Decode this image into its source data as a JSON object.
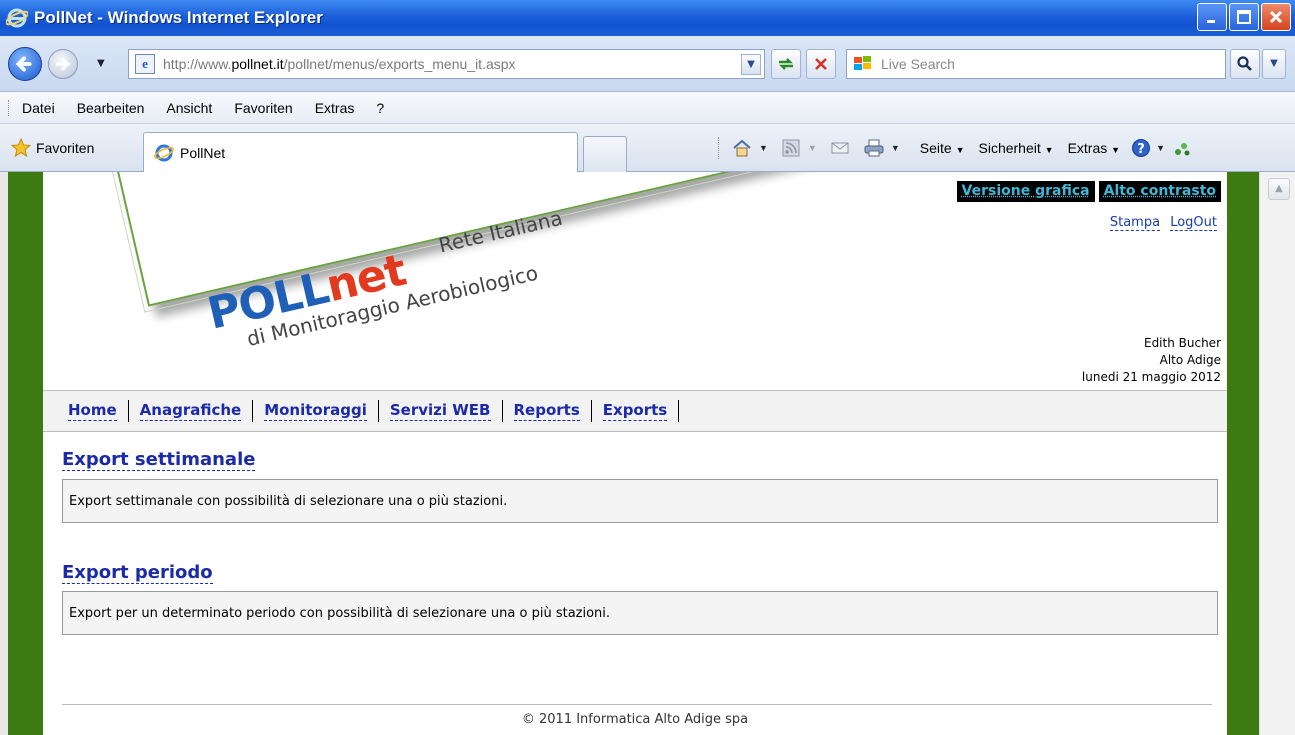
{
  "window": {
    "title": "PollNet - Windows Internet Explorer"
  },
  "address_bar": {
    "url_prefix": "http://www.",
    "url_domain": "pollnet.it",
    "url_path": "/pollnet/menus/exports_menu_it.aspx",
    "search_placeholder": "Live Search"
  },
  "menu": {
    "items": [
      "Datei",
      "Bearbeiten",
      "Ansicht",
      "Favoriten",
      "Extras",
      "?"
    ]
  },
  "favorites_bar": {
    "favorites_label": "Favoriten",
    "tab_title": "PollNet",
    "page_label": "Seite",
    "security_label": "Sicherheit",
    "extras_label": "Extras"
  },
  "page": {
    "logo": {
      "part1": "POLL",
      "part2": "net",
      "subtitle1": "Rete Italiana",
      "subtitle2": "di Monitoraggio Aerobiologico"
    },
    "mode_links": [
      "Versione grafica",
      "Alto contrasto"
    ],
    "util_links": [
      "Stampa",
      "LogOut"
    ],
    "user": {
      "name": "Edith Bucher",
      "region": "Alto Adige",
      "date": "lunedi 21 maggio 2012"
    },
    "nav": [
      "Home",
      "Anagrafiche",
      "Monitoraggi",
      "Servizi WEB",
      "Reports",
      "Exports"
    ],
    "sections": [
      {
        "title": "Export settimanale",
        "description": "Export settimanale con possibilità di selezionare una o più stazioni."
      },
      {
        "title": "Export periodo",
        "description": "Export per un determinato periodo con possibilità di selezionare una o più stazioni."
      }
    ],
    "footer": "© 2011 Informatica Alto Adige spa"
  },
  "colors": {
    "titlebar": "#1c5fd9",
    "frame_green": "#3d7a11",
    "link_blue": "#1a2aa8",
    "contrast_cyan": "#3fb8d6",
    "logo_blue": "#1f5fb5",
    "logo_red": "#e23a1e",
    "dot_orange": "#f39a12"
  }
}
